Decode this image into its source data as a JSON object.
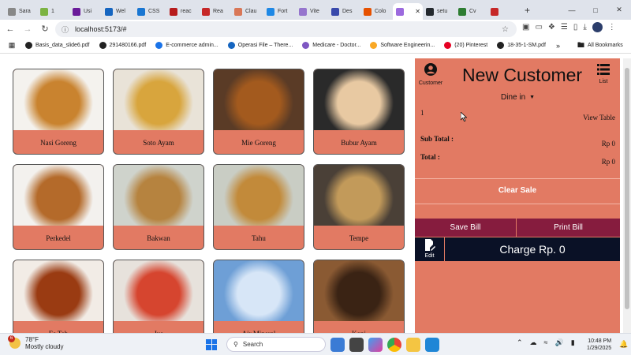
{
  "browser": {
    "tabs": [
      {
        "label": "Sara",
        "color": "#888888"
      },
      {
        "label": "1",
        "color": "#7cb342"
      },
      {
        "label": "Usi",
        "color": "#6a1b9a"
      },
      {
        "label": "Wel",
        "color": "#1565c0"
      },
      {
        "label": "CSS",
        "color": "#1976d2"
      },
      {
        "label": "reac",
        "color": "#b71c1c"
      },
      {
        "label": "Rea",
        "color": "#c62828"
      },
      {
        "label": "Clau",
        "color": "#d97757"
      },
      {
        "label": "Fort",
        "color": "#1e88e5"
      },
      {
        "label": "Vite",
        "color": "#9575cd"
      },
      {
        "label": "Des",
        "color": "#3949ab"
      },
      {
        "label": "Colo",
        "color": "#e65100"
      },
      {
        "label": "",
        "color": "#9c6ade",
        "active": true
      },
      {
        "label": "setu",
        "color": "#24292e"
      },
      {
        "label": "Cv",
        "color": "#2e7d32"
      },
      {
        "label": "",
        "color": "#c62828"
      }
    ],
    "url": "localhost:5173/#",
    "bookmarks": [
      {
        "label": "Basis_data_slide6.pdf",
        "color": "#222222"
      },
      {
        "label": "291480166.pdf",
        "color": "#222222"
      },
      {
        "label": "E-commerce admin...",
        "color": "#1a73e8"
      },
      {
        "label": "Operasi File – There...",
        "color": "#1565c0"
      },
      {
        "label": "Medicare - Doctor...",
        "color": "#7e57c2"
      },
      {
        "label": "Software Engineerin...",
        "color": "#f9a825"
      },
      {
        "label": "(20) Pinterest",
        "color": "#e60023"
      },
      {
        "label": "18-35-1-SM.pdf",
        "color": "#222222"
      }
    ],
    "all_bookmarks": "All Bookmarks"
  },
  "menu": [
    {
      "name": "Nasi Goreng",
      "colors": [
        "#f4f2ee",
        "#c9832f"
      ]
    },
    {
      "name": "Soto Ayam",
      "colors": [
        "#e9e3d8",
        "#d8a53d"
      ]
    },
    {
      "name": "Mie Goreng",
      "colors": [
        "#5a3b26",
        "#a35a1e"
      ]
    },
    {
      "name": "Bubur Ayam",
      "colors": [
        "#2a2a2a",
        "#e8c9a2"
      ]
    },
    {
      "name": "Perkedel",
      "colors": [
        "#f3f1ee",
        "#b46a2a"
      ]
    },
    {
      "name": "Bakwan",
      "colors": [
        "#cfd3cc",
        "#b6833f"
      ]
    },
    {
      "name": "Tahu",
      "colors": [
        "#c9cdc4",
        "#c28a3a"
      ]
    },
    {
      "name": "Tempe",
      "colors": [
        "#4a4037",
        "#c29a5a"
      ]
    },
    {
      "name": "Es Teh",
      "colors": [
        "#f2ece6",
        "#9a3b12"
      ]
    },
    {
      "name": "Jus",
      "colors": [
        "#e7e2dc",
        "#d6452f"
      ]
    },
    {
      "name": "Air Mineral",
      "colors": [
        "#6e9fd6",
        "#d7e6f7"
      ]
    },
    {
      "name": "Kopi",
      "colors": [
        "#8a5a33",
        "#3a2314"
      ]
    }
  ],
  "order": {
    "customer_label": "Customer",
    "title": "New Customer",
    "list_label": "List",
    "dine_option": "Dine in",
    "table_number": "1",
    "view_table": "View Table",
    "subtotal_label": "Sub Total :",
    "subtotal_value": "Rp 0",
    "total_label": "Total :",
    "total_value": "Rp 0",
    "clear_sale": "Clear Sale",
    "save_bill": "Save Bill",
    "print_bill": "Print Bill",
    "edit_label": "Edit",
    "charge": "Charge Rp. 0"
  },
  "colors": {
    "panel": "#e27a63",
    "button_dark": "#861c3e",
    "charge_bg": "#0a1126"
  },
  "taskbar": {
    "temp": "78°F",
    "weather": "Mostly cloudy",
    "badge": "6",
    "search": "Search",
    "time": "10:48 PM",
    "date": "1/29/2025"
  }
}
